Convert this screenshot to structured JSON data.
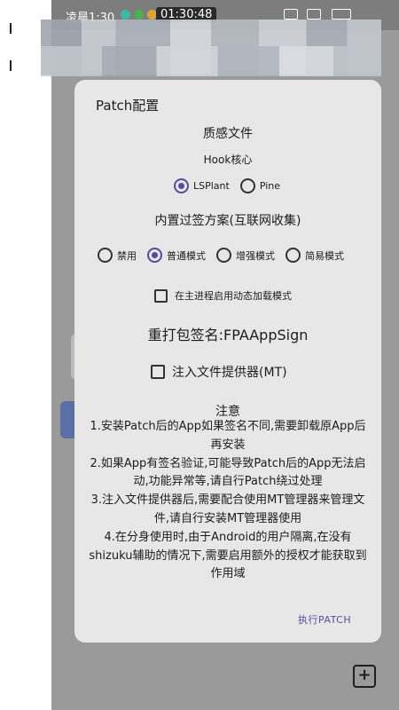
{
  "status_bar": {
    "time": "凌晨1:30",
    "clock": "01:30:48"
  },
  "dialog": {
    "title": "Patch配置",
    "texture_file_label": "质感文件",
    "hook_core_label": "Hook核心",
    "hook_options": [
      {
        "label": "LSPlant",
        "selected": true
      },
      {
        "label": "Pine",
        "selected": false
      }
    ],
    "signature_bypass_label": "内置过签方案(互联网收集)",
    "bypass_options": [
      {
        "label": "禁用",
        "selected": false
      },
      {
        "label": "普通模式",
        "selected": true
      },
      {
        "label": "增强模式",
        "selected": false
      },
      {
        "label": "简易模式",
        "selected": false
      }
    ],
    "dynamic_load_checkbox": {
      "label": "在主进程启用动态加载模式",
      "checked": false
    },
    "resign_label": "重打包签名:FPAAppSign",
    "file_provider_checkbox": {
      "label": "注入文件提供器(MT)",
      "checked": false
    },
    "notes_title": "注意",
    "notes": [
      "1.安装Patch后的App如果签名不同,需要卸载原App后再安装",
      "2.如果App有签名验证,可能导致Patch后的App无法启动,功能异常等,请自行Patch绕过处理",
      "3.注入文件提供器后,需要配合使用MT管理器来管理文件,请自行安装MT管理器使用",
      "4.在分身使用时,由于Android的用户隔离,在没有shizuku辅助的情况下,需要启用额外的授权才能获取到作用域"
    ],
    "execute_button": "执行PATCH"
  },
  "colors": {
    "accent": "#5b4aa0",
    "dialog_bg": "#e7e7e7",
    "scrim": "#8e8e8e"
  }
}
